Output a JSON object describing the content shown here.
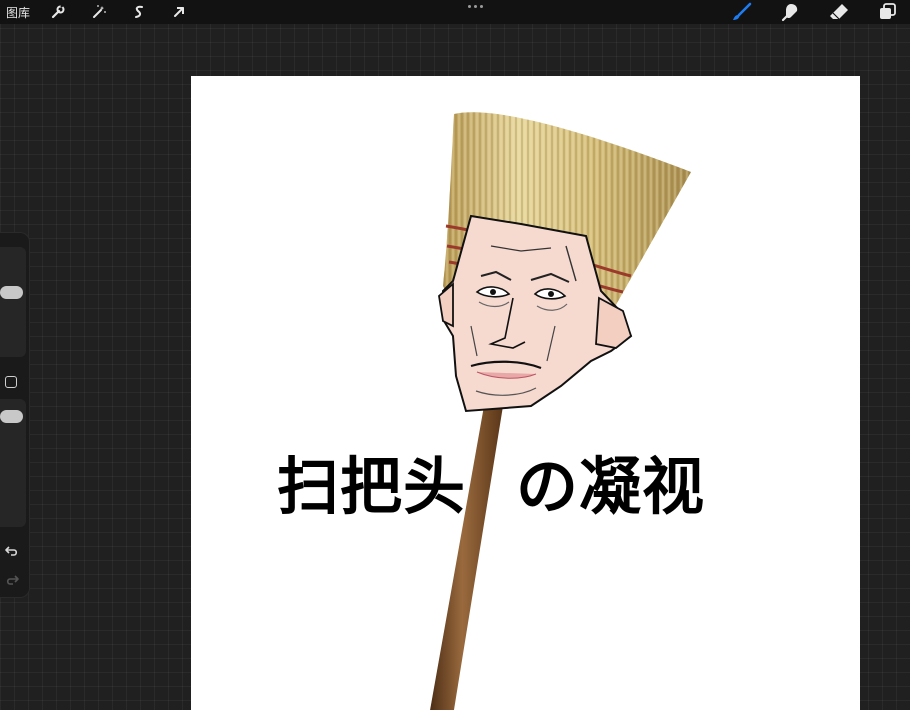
{
  "topbar": {
    "gallery_label": "图库",
    "left_tools": [
      {
        "name": "actions-wrench-icon"
      },
      {
        "name": "adjustments-magic-wand-icon"
      },
      {
        "name": "selection-s-icon"
      },
      {
        "name": "transform-arrow-icon"
      }
    ],
    "right_tools": [
      {
        "name": "brush-icon",
        "active": true,
        "color": "#1e7cf2"
      },
      {
        "name": "smudge-icon"
      },
      {
        "name": "eraser-icon"
      },
      {
        "name": "layers-icon"
      }
    ]
  },
  "sidebar": {
    "brush_size_slider": "brush-size-slider",
    "opacity_slider": "opacity-slider",
    "modify_button": "modify-button",
    "undo": "undo-icon",
    "redo": "redo-icon"
  },
  "canvas": {
    "caption_left": "扫把头",
    "caption_right": "の凝视",
    "background": "#ffffff"
  },
  "colors": {
    "accent": "#1e7cf2",
    "toolbar_bg": "#121212",
    "workspace_bg": "#202020"
  }
}
